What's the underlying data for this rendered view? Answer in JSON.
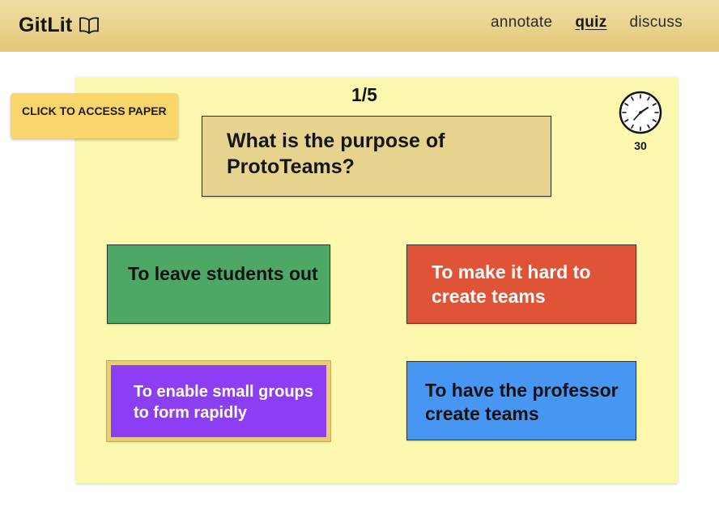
{
  "header": {
    "brand": "GitLit",
    "nav": [
      {
        "label": "annotate",
        "active": false
      },
      {
        "label": "quiz",
        "active": true
      },
      {
        "label": "discuss",
        "active": false
      }
    ]
  },
  "access_paper_label": "CLICK TO ACCESS PAPER",
  "quiz": {
    "progress": "1/5",
    "timer_seconds": "30",
    "question": "What is the purpose of ProtoTeams?",
    "answers": [
      {
        "label": "To leave students out",
        "color": "#4ea865",
        "selected": false
      },
      {
        "label": "To make it hard to create teams",
        "color": "#df5436",
        "selected": false
      },
      {
        "label": "To enable small groups to form rapidly",
        "color": "#8c3ff2",
        "selected": true
      },
      {
        "label": "To have the professor create teams",
        "color": "#4796f2",
        "selected": false
      }
    ]
  },
  "colors": {
    "header_top": "#efdfa5",
    "header_bottom": "#e3c777",
    "board": "#fcf8ae",
    "access_button": "#fad56b",
    "question_card": "#e6d48e",
    "selected_border": "#e8cc7a"
  },
  "icons": {
    "brand": "open-book-icon",
    "timer": "clock-icon"
  }
}
